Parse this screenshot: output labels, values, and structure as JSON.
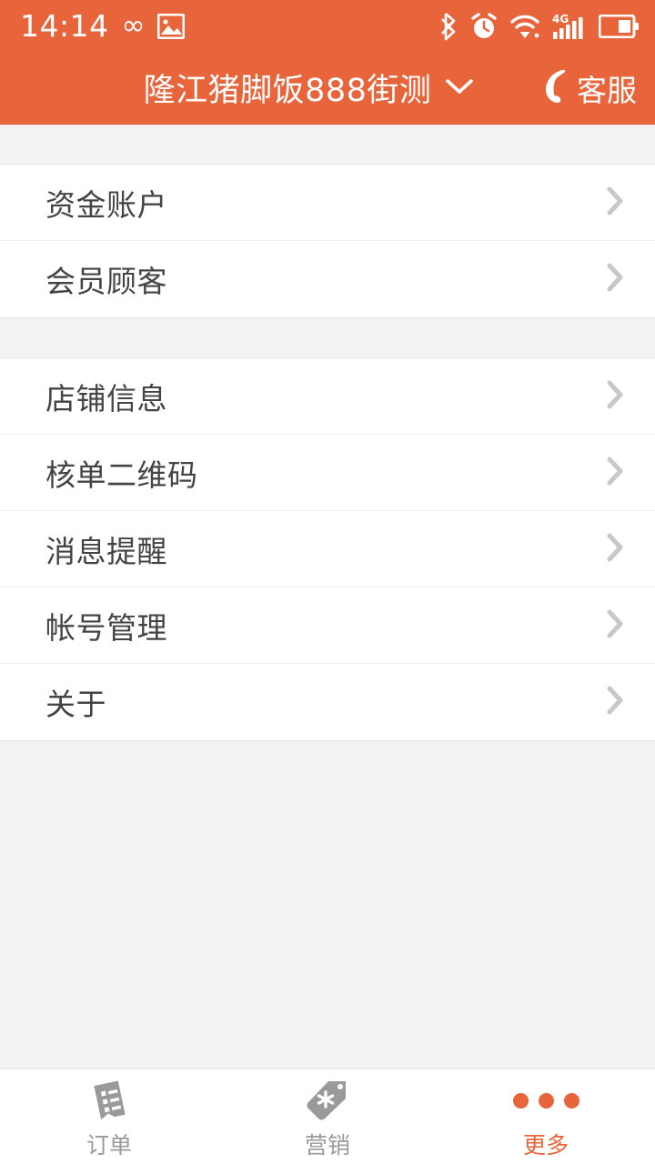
{
  "statusbar": {
    "time": "14:14",
    "infinity_glyph": "∞",
    "icons_left": [
      "infinity-icon",
      "image-icon"
    ],
    "icons_right": [
      "bluetooth-icon",
      "alarm-clock-icon",
      "wifi-icon",
      "signal-4g-icon",
      "battery-icon"
    ],
    "network_label": "4G"
  },
  "header": {
    "title": "隆江猪脚饭888街测",
    "dropdown_icon": "chevron-down-icon",
    "support_label": "客服",
    "support_icon": "phone-icon",
    "background_color": "#e8643a"
  },
  "groups": [
    {
      "rows": [
        {
          "label": "资金账户",
          "chevron": "chevron-right-icon"
        },
        {
          "label": "会员顾客",
          "chevron": "chevron-right-icon"
        }
      ]
    },
    {
      "rows": [
        {
          "label": "店铺信息",
          "chevron": "chevron-right-icon"
        },
        {
          "label": "核单二维码",
          "chevron": "chevron-right-icon"
        },
        {
          "label": "消息提醒",
          "chevron": "chevron-right-icon"
        },
        {
          "label": "帐号管理",
          "chevron": "chevron-right-icon"
        },
        {
          "label": "关于",
          "chevron": "chevron-right-icon"
        }
      ]
    }
  ],
  "tabbar": {
    "tabs": [
      {
        "label": "订单",
        "icon": "receipt-icon",
        "active": false
      },
      {
        "label": "营销",
        "icon": "price-tag-icon",
        "active": false
      },
      {
        "label": "更多",
        "icon": "ellipsis-icon",
        "active": true
      }
    ],
    "active_color": "#e8643a",
    "inactive_color": "#9a9a9a"
  }
}
